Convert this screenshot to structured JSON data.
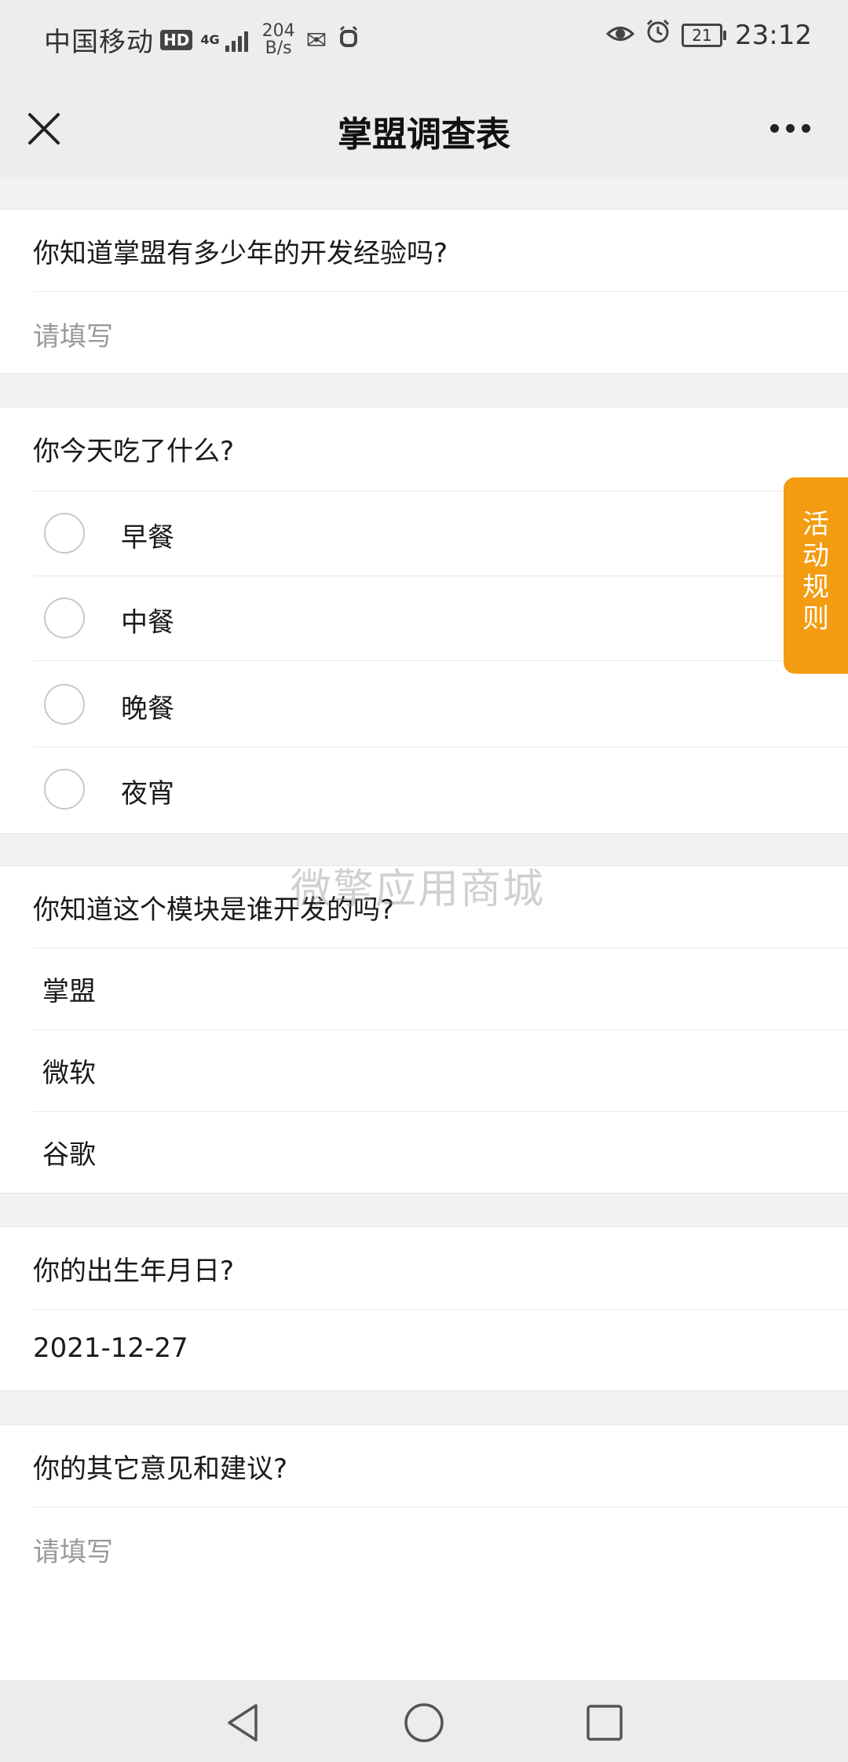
{
  "status_bar": {
    "carrier": "中国移动",
    "hd": "HD",
    "network": "4G",
    "speed_value": "204",
    "speed_unit": "B/s",
    "battery": "21",
    "time": "23:12"
  },
  "header": {
    "title": "掌盟调查表"
  },
  "questions": [
    {
      "title": "你知道掌盟有多少年的开发经验吗?",
      "placeholder": "请填写"
    },
    {
      "title": "你今天吃了什么?",
      "options": [
        "早餐",
        "中餐",
        "晚餐",
        "夜宵"
      ]
    },
    {
      "title": "你知道这个模块是谁开发的吗?",
      "options": [
        "掌盟",
        "微软",
        "谷歌"
      ]
    },
    {
      "title": "你的出生年月日?",
      "value": "2021-12-27"
    },
    {
      "title": "你的其它意见和建议?",
      "placeholder": "请填写"
    }
  ],
  "side_tab": {
    "label": "活动规则"
  },
  "watermark": "微擎应用商城",
  "colors": {
    "accent": "#f39c12",
    "background": "#f2f2f2",
    "header": "#ededed"
  }
}
